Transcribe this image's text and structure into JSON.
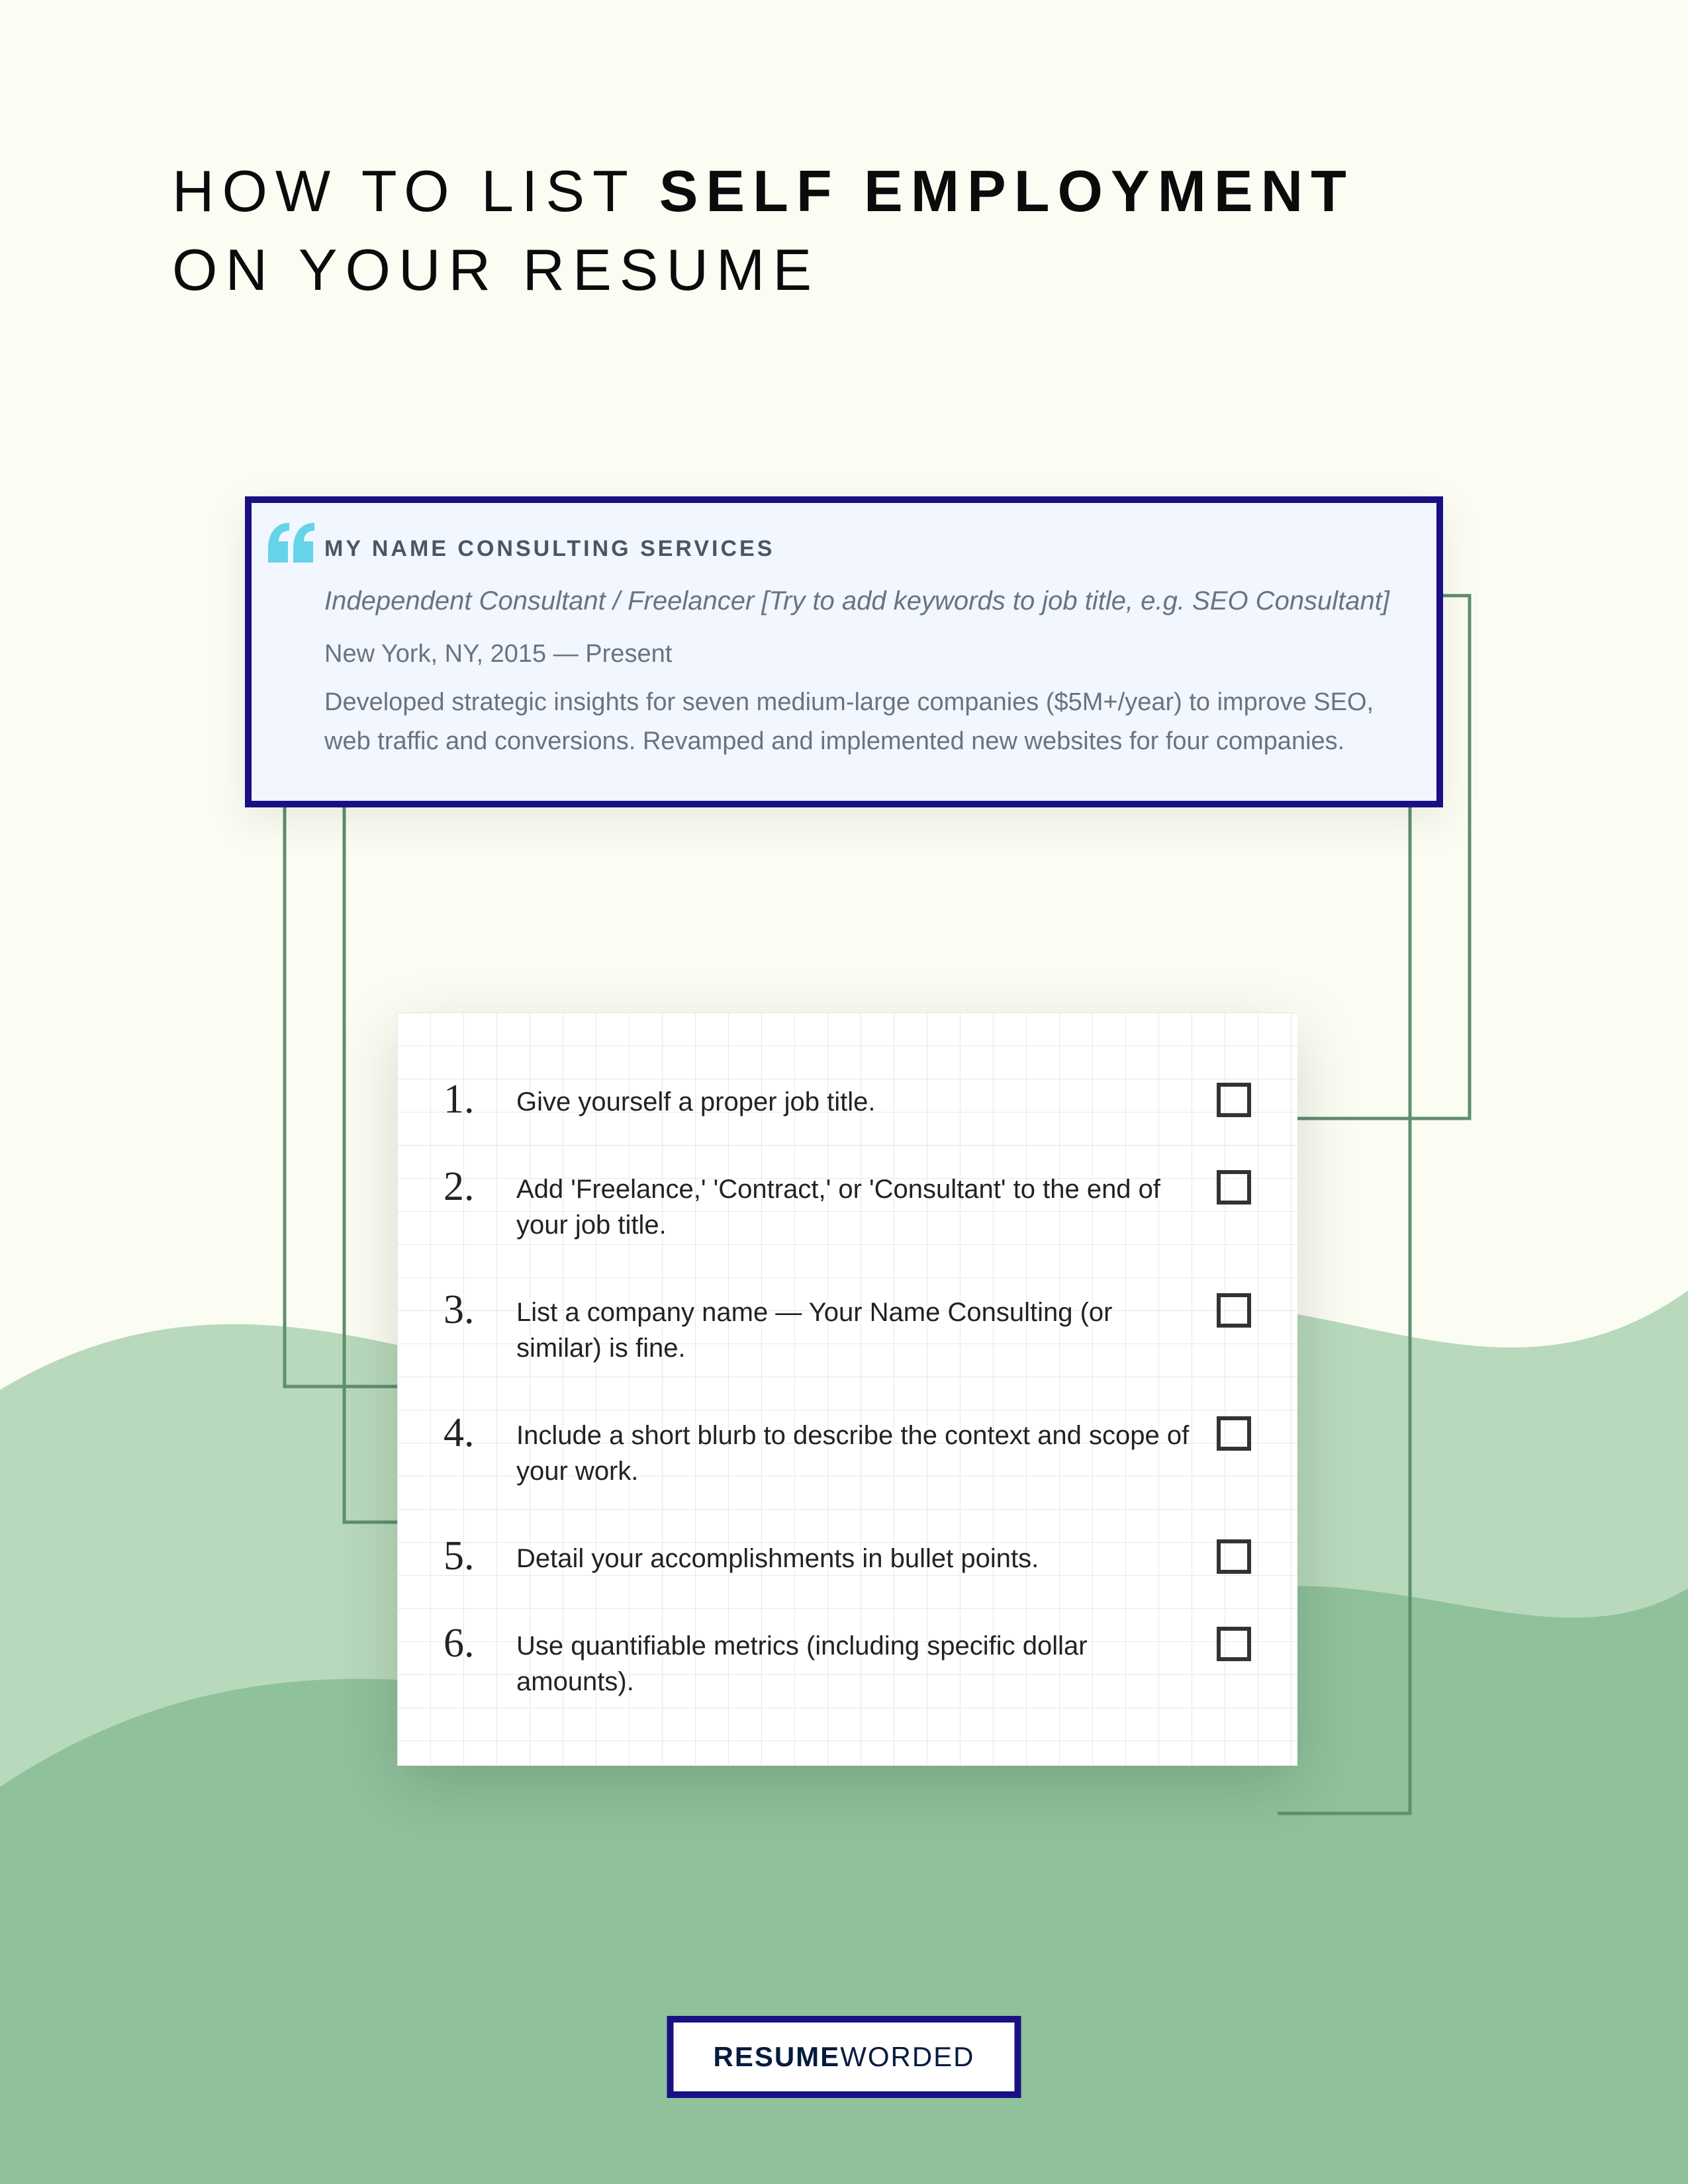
{
  "heading": {
    "pre": "HOW TO LIST ",
    "bold": "SELF EMPLOYMENT",
    "post": "ON YOUR RESUME"
  },
  "example": {
    "company": "MY NAME CONSULTING SERVICES",
    "jobtitle": "Independent Consultant / Freelancer [Try to add keywords to job title, e.g. SEO Consultant]",
    "meta": "New York, NY, 2015 — Present",
    "description": "Developed strategic insights for seven medium-large companies ($5M+/year) to improve SEO, web traffic and conversions. Revamped and implemented new websites for four companies."
  },
  "tips": [
    {
      "num": "1.",
      "text": "Give yourself a proper job title."
    },
    {
      "num": "2.",
      "text": "Add 'Freelance,' 'Contract,' or 'Consultant' to the end of your job title."
    },
    {
      "num": "3.",
      "text": "List a company name — Your Name Consulting (or similar) is fine."
    },
    {
      "num": "4.",
      "text": "Include a short blurb to describe the context and scope of your work."
    },
    {
      "num": "5.",
      "text": "Detail your accomplishments in bullet points."
    },
    {
      "num": "6.",
      "text": "Use quantifiable metrics (including specific dollar amounts)."
    }
  ],
  "logo": {
    "resume": "RESUME",
    "worded": "WORDED"
  }
}
